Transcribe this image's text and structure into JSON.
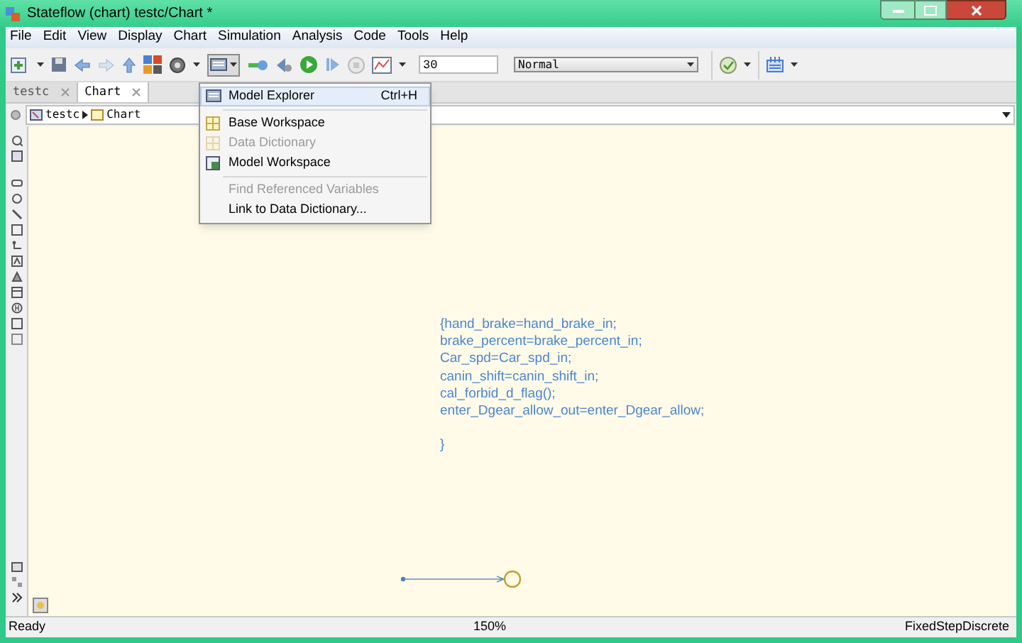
{
  "window": {
    "title": "Stateflow (chart) testc/Chart *"
  },
  "menu_bar": [
    "File",
    "Edit",
    "View",
    "Display",
    "Chart",
    "Simulation",
    "Analysis",
    "Code",
    "Tools",
    "Help"
  ],
  "toolbar": {
    "stop_time": "30",
    "sim_mode": "Normal"
  },
  "tabs": [
    {
      "label": "testc",
      "selected": false
    },
    {
      "label": "Chart",
      "selected": true
    }
  ],
  "breadcrumb": [
    "testc",
    "Chart"
  ],
  "dropdown_menu": [
    {
      "label": "Model Explorer",
      "shortcut": "Ctrl+H",
      "kind": "item",
      "disabled": false,
      "highlighted": true
    },
    {
      "kind": "separator"
    },
    {
      "label": "Base Workspace",
      "kind": "item",
      "disabled": false,
      "highlighted": false
    },
    {
      "label": "Data Dictionary",
      "kind": "item",
      "disabled": true,
      "highlighted": false
    },
    {
      "label": "Model Workspace",
      "kind": "item",
      "disabled": false,
      "highlighted": false
    },
    {
      "kind": "separator"
    },
    {
      "label": "Find Referenced Variables",
      "kind": "item",
      "disabled": true,
      "highlighted": false
    },
    {
      "label": "Link to Data Dictionary...",
      "kind": "item",
      "disabled": false,
      "highlighted": false
    }
  ],
  "canvas": {
    "code_lines": [
      "{hand_brake=hand_brake_in;",
      "brake_percent=brake_percent_in;",
      "Car_spd=Car_spd_in;",
      "canin_shift=canin_shift_in;",
      "cal_forbid_d_flag();",
      "enter_Dgear_allow_out=enter_Dgear_allow;"
    ],
    "closing": "}"
  },
  "status_bar": {
    "state": "Ready",
    "zoom": "150%",
    "solver": "FixedStepDiscrete"
  }
}
